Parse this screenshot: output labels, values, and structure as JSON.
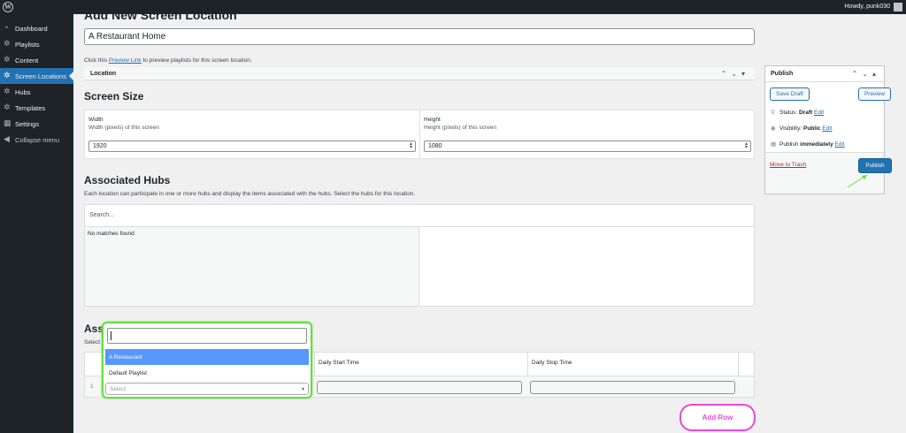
{
  "admin_bar": {
    "greeting": "Howdy, punk030"
  },
  "sidebar": {
    "items": [
      {
        "label": "Dashboard",
        "icon": "dashboard-icon"
      },
      {
        "label": "Playlists",
        "icon": "gear-icon"
      },
      {
        "label": "Content",
        "icon": "gear-icon"
      },
      {
        "label": "Screen Locations",
        "icon": "gear-icon",
        "current": true
      },
      {
        "label": "Hubs",
        "icon": "gear-icon"
      },
      {
        "label": "Templates",
        "icon": "gear-icon"
      },
      {
        "label": "Settings",
        "icon": "settings-icon"
      },
      {
        "label": "Collapse menu",
        "icon": "collapse-icon"
      }
    ]
  },
  "page": {
    "title": "Add New Screen Location"
  },
  "title_field": {
    "value": "A Restaurant Home"
  },
  "preview_note": {
    "before": "Click this ",
    "link": "Preview Link",
    "after": " to preview playlists for this screen location."
  },
  "location_box": {
    "label": "Location"
  },
  "screen_size": {
    "heading": "Screen Size",
    "width": {
      "label": "Width",
      "desc": "Width (pixels) of this screen",
      "value": "1920"
    },
    "height": {
      "label": "Height",
      "desc": "Height (pixels) of this screen",
      "value": "1080"
    }
  },
  "hubs": {
    "heading": "Associated Hubs",
    "desc": "Each location can participate in one or more hubs and display the items associated with the hubs. Select the hubs for this location.",
    "search_placeholder": "Search...",
    "empty": "No matches found"
  },
  "playlists": {
    "heading": "Associated Playlists",
    "sub": "Select",
    "columns": [
      "Daily Start Time",
      "Daily Stop Time"
    ],
    "rows": [
      {
        "num": "1"
      }
    ]
  },
  "dropdown": {
    "options": [
      "A Restaurant",
      "Default Playlist"
    ],
    "highlighted": "A Restaurant",
    "select_placeholder": "Select"
  },
  "add_row": {
    "label": "Add Row"
  },
  "publish": {
    "title": "Publish",
    "save_draft": "Save Draft",
    "preview": "Preview",
    "status_label": "Status:",
    "status_value": "Draft",
    "visibility_label": "Visibility:",
    "visibility_value": "Public",
    "publish_label": "Publish",
    "publish_value": "immediately",
    "edit": "Edit",
    "trash": "Move to Trash",
    "publish_button": "Publish"
  },
  "colors": {
    "accent": "#2271b1",
    "highlight_ring": "#66dd44",
    "add_row": "#e24bd6"
  }
}
